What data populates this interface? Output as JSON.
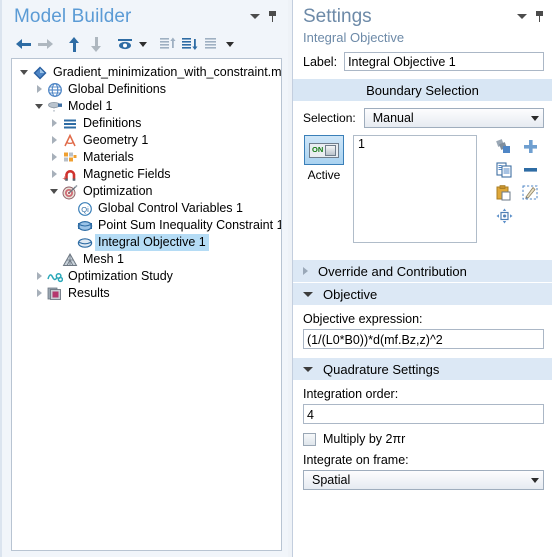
{
  "model_builder": {
    "title": "Model Builder",
    "header_icons": [
      "chevron-down-icon",
      "pin-icon"
    ],
    "toolbar": [
      {
        "name": "back-button",
        "icon": "arrow-left-icon",
        "enabled": true
      },
      {
        "name": "forward-button",
        "icon": "arrow-right-icon",
        "enabled": false
      },
      {
        "name": "move-up-button",
        "icon": "arrow-up-icon",
        "enabled": true
      },
      {
        "name": "move-down-button",
        "icon": "arrow-down-icon",
        "enabled": false
      },
      {
        "name": "show-button",
        "icon": "eye-icon",
        "enabled": true
      },
      {
        "name": "show-dropdown",
        "icon": "chevron-down-icon",
        "enabled": true
      },
      {
        "name": "expand-all-button",
        "icon": "list-up-icon",
        "enabled": false
      },
      {
        "name": "collapse-all-button",
        "icon": "list-down-icon",
        "enabled": true
      },
      {
        "name": "list-options-button",
        "icon": "list-icon",
        "enabled": false
      },
      {
        "name": "list-options-dropdown",
        "icon": "chevron-down-icon",
        "enabled": true
      }
    ],
    "tree": [
      {
        "label": "Gradient_minimization_with_constraint.mph",
        "depth": 0,
        "twisty": "open",
        "icon": "root-model-icon",
        "selected": false
      },
      {
        "label": "Global Definitions",
        "depth": 1,
        "twisty": "closed",
        "icon": "globe-icon",
        "selected": false
      },
      {
        "label": "Model 1",
        "depth": 1,
        "twisty": "open",
        "icon": "model-node-icon",
        "selected": false
      },
      {
        "label": "Definitions",
        "depth": 2,
        "twisty": "closed",
        "icon": "definitions-icon",
        "selected": false
      },
      {
        "label": "Geometry 1",
        "depth": 2,
        "twisty": "closed",
        "icon": "geometry-icon",
        "selected": false
      },
      {
        "label": "Materials",
        "depth": 2,
        "twisty": "closed",
        "icon": "materials-icon",
        "selected": false
      },
      {
        "label": "Magnetic Fields",
        "depth": 2,
        "twisty": "closed",
        "icon": "magnet-icon",
        "selected": false
      },
      {
        "label": "Optimization",
        "depth": 2,
        "twisty": "open",
        "icon": "optimization-target-icon",
        "selected": false
      },
      {
        "label": "Global Control Variables 1",
        "depth": 3,
        "twisty": "none",
        "icon": "global-control-variables-icon",
        "selected": false
      },
      {
        "label": "Point Sum Inequality Constraint 1",
        "depth": 3,
        "twisty": "none",
        "icon": "constraint-icon",
        "selected": false
      },
      {
        "label": "Integral Objective 1",
        "depth": 3,
        "twisty": "none",
        "icon": "integral-objective-icon",
        "selected": true
      },
      {
        "label": "Mesh 1",
        "depth": 2,
        "twisty": "none",
        "icon": "mesh-icon",
        "selected": false
      },
      {
        "label": "Optimization Study",
        "depth": 1,
        "twisty": "closed",
        "icon": "study-icon",
        "selected": false
      },
      {
        "label": "Results",
        "depth": 1,
        "twisty": "closed",
        "icon": "results-icon",
        "selected": false
      }
    ]
  },
  "settings": {
    "title": "Settings",
    "subtitle": "Integral Objective",
    "header_icons": [
      "chevron-down-icon",
      "pin-icon"
    ],
    "label_field": {
      "label": "Label:",
      "value": "Integral Objective 1"
    },
    "boundary_selection": {
      "header": "Boundary Selection",
      "selection_label": "Selection:",
      "selection_value": "Manual",
      "active_toggle_state": "ON",
      "active_caption": "Active",
      "list_items": [
        "1"
      ],
      "tools": [
        "create-selection-icon",
        "add-to-selection-icon",
        "copy-icon",
        "remove-from-selection-icon",
        "paste-icon",
        "clear-selection-icon",
        "zoom-to-selection-icon"
      ]
    },
    "override_and_contribution": {
      "header": "Override and Contribution",
      "expanded": false
    },
    "objective": {
      "header": "Objective",
      "expanded": true,
      "expression_label": "Objective expression:",
      "expression_value": "(1/(L0*B0))*d(mf.Bz,z)^2"
    },
    "quadrature_settings": {
      "header": "Quadrature Settings",
      "expanded": true,
      "integration_order_label": "Integration order:",
      "integration_order_value": "4",
      "multiply_label": "Multiply by 2πr",
      "multiply_checked": false,
      "frame_label": "Integrate on frame:",
      "frame_value": "Spatial"
    }
  },
  "colors": {
    "panel_title": "#5b9bd5",
    "settings_title": "#6d8aa8",
    "section_header_bg": "#dce8f5",
    "selection_highlight": "#b5dcf5",
    "accent_blue": "#2e6ca4"
  }
}
